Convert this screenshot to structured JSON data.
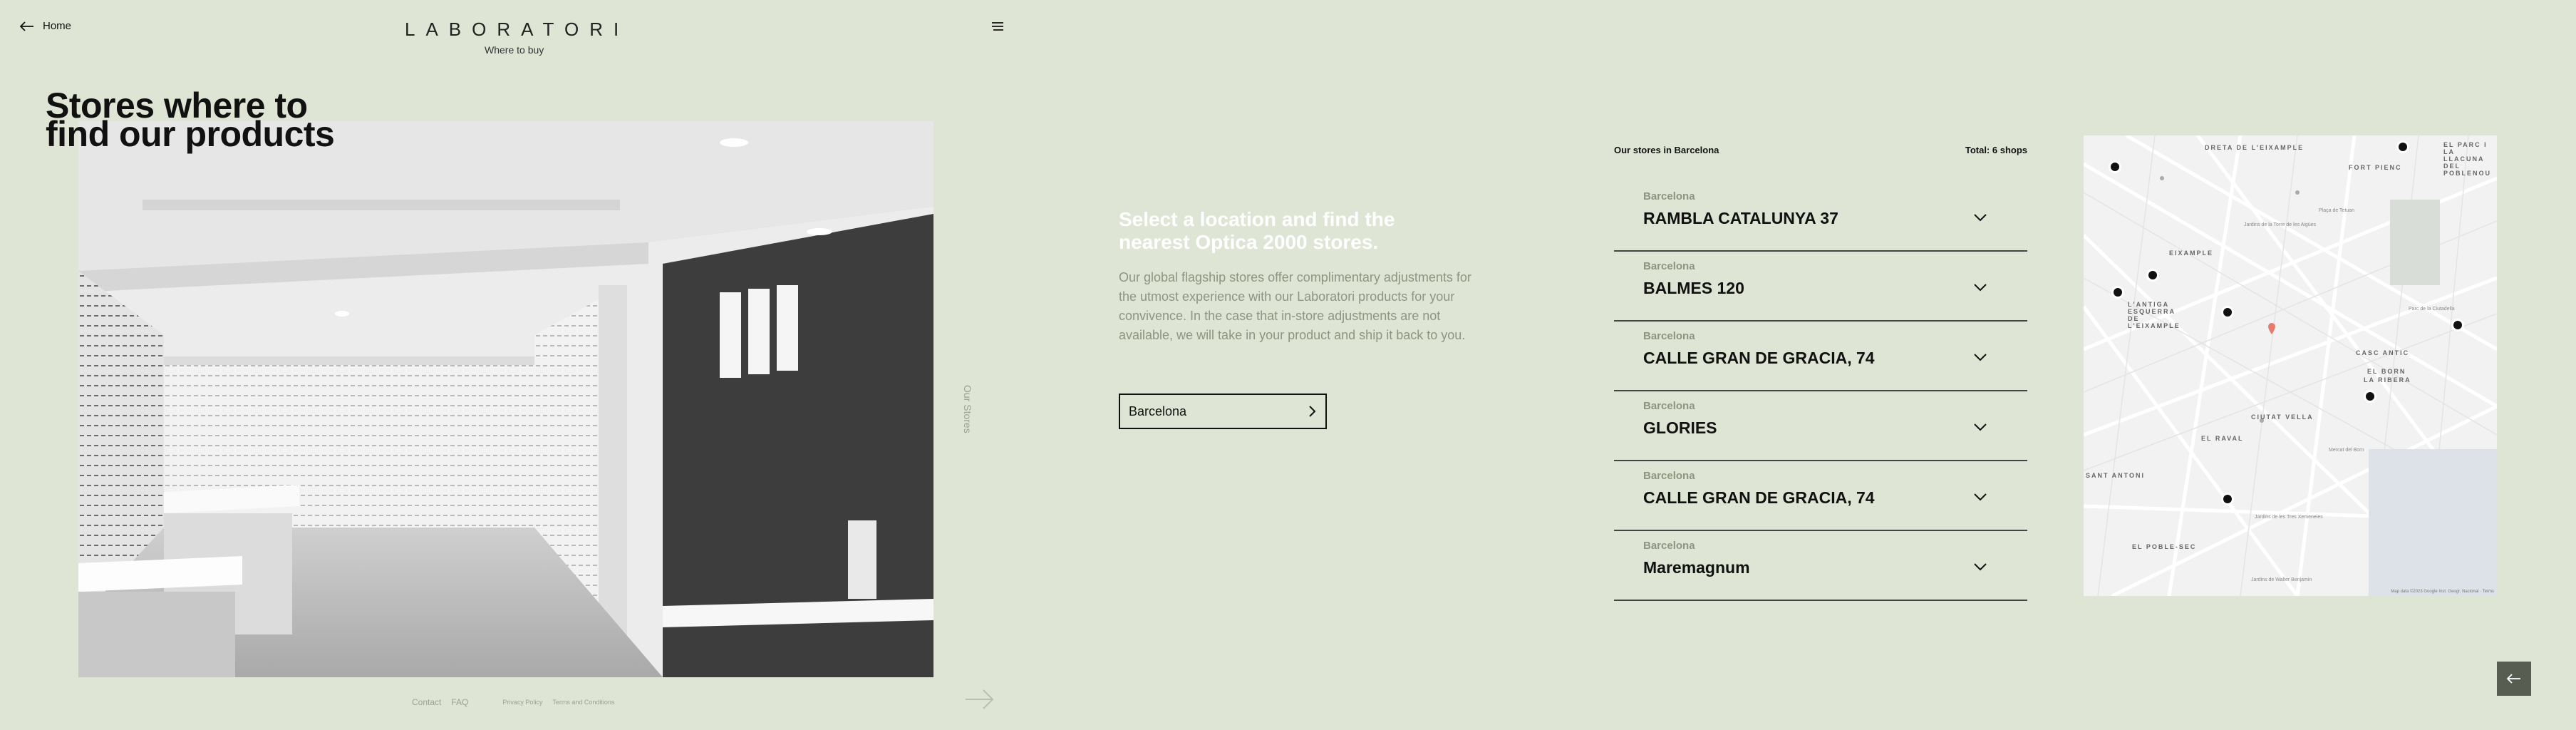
{
  "header": {
    "home_label": "Home",
    "brand": "LABORATORI",
    "subtitle": "Where to buy"
  },
  "hero": {
    "title_line1": "Stores where to",
    "title_line2": "find our products",
    "side_label": "Our Stores"
  },
  "footer": {
    "contact": "Contact",
    "faq": "FAQ",
    "privacy": "Privacy Policy",
    "terms": "Terms and Conditions"
  },
  "cta": {
    "title": "Select a location and find the nearest Optica 2000 stores.",
    "description": "Our global flagship stores offer complimentary adjustments for the utmost experience with our Laboratori products for your convivence. In the case that in-store adjustments are not available, we will take in your product and ship it back to you.",
    "selected_location": "Barcelona"
  },
  "stores_header": {
    "label": "Our stores in Barcelona",
    "total": "Total: 6 shops"
  },
  "stores": [
    {
      "city": "Barcelona",
      "name": "RAMBLA CATALUNYA 37"
    },
    {
      "city": "Barcelona",
      "name": "BALMES 120"
    },
    {
      "city": "Barcelona",
      "name": "CALLE GRAN DE GRACIA, 74"
    },
    {
      "city": "Barcelona",
      "name": "GLORIES"
    },
    {
      "city": "Barcelona",
      "name": "CALLE GRAN DE GRACIA, 74"
    },
    {
      "city": "Barcelona",
      "name": "Maremagnum"
    }
  ],
  "map": {
    "labels": [
      "DRETA DE L'EIXAMPLE",
      "FORT PIENC",
      "EL PARC I LA LLACUNA DEL POBLENOU",
      "EIXAMPLE",
      "L'ANTIGA ESQUERRA DE L'EIXAMPLE",
      "CASC ANTIC",
      "EL BORN",
      "LA RIBERA",
      "CIUTAT VELLA",
      "EL RAVAL",
      "SANT ANTONI",
      "EL POBLE-SEC"
    ],
    "small_labels": [
      "Jardins de la Torre de les Aigües",
      "Plaça de Tetuan",
      "Parc de la Ciutadella",
      "Mercat del Born",
      "Jardins de les Tres Xemeneies",
      "Jardins de Walter Benjamin"
    ],
    "credit": "Map data ©2023 Google Inst. Geogr. Nacional · Terms"
  },
  "icons": {
    "home": "arrow-left-icon",
    "menu": "menu-icon",
    "chevron": "chevron-down-icon",
    "select": "chevron-right-icon",
    "next": "arrow-right-icon",
    "back": "arrow-left-icon",
    "pin": "map-pin-icon"
  },
  "colors": {
    "background": "#dfe5d4",
    "accent_text": "#8d9581",
    "back_button": "#585d52"
  }
}
